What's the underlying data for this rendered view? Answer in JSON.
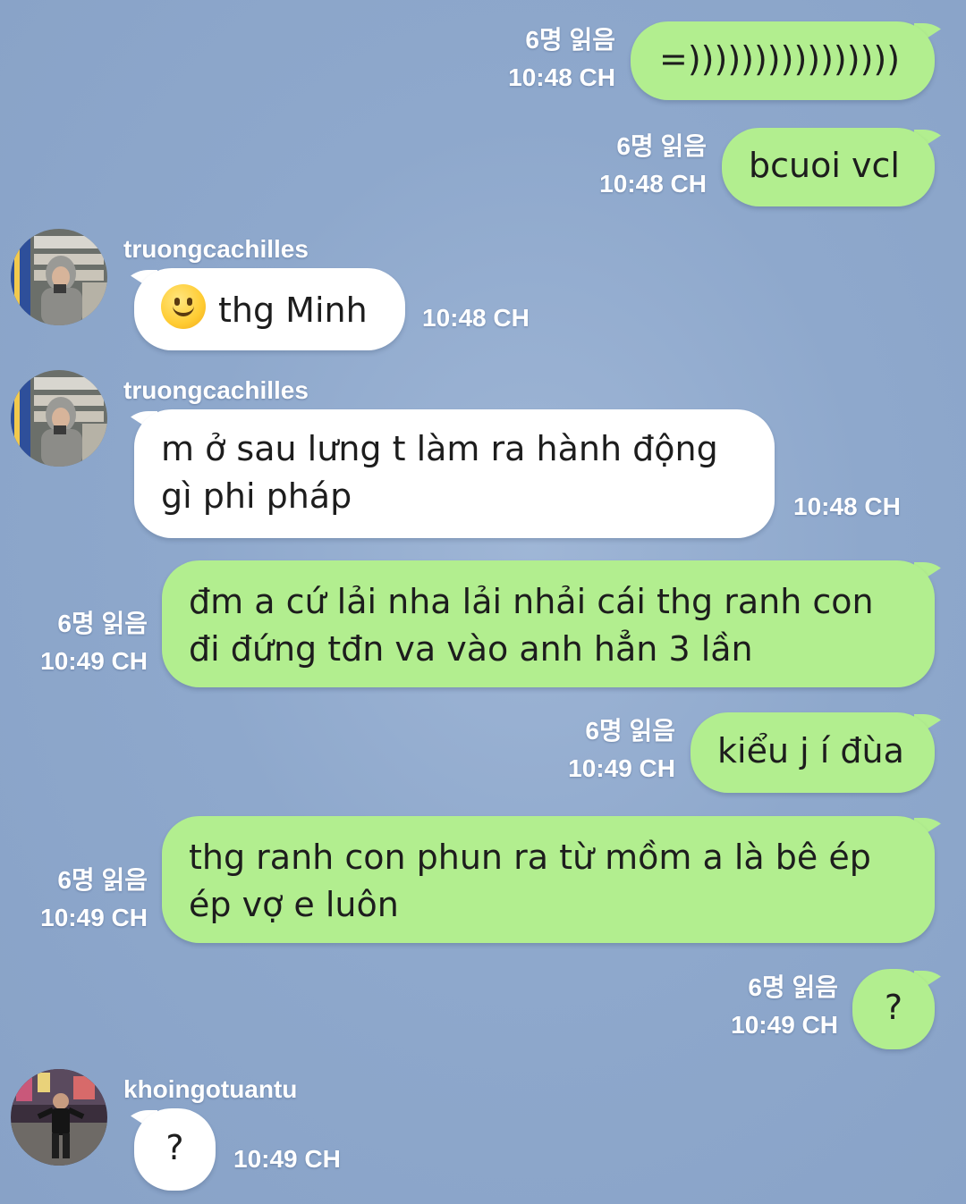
{
  "colors": {
    "background": "#8da6cb",
    "outgoing_bubble": "#b2ee8f",
    "incoming_bubble": "#ffffff"
  },
  "messages": [
    {
      "direction": "out",
      "text": "=))))))))))))))))",
      "read": "6명 읽음",
      "time": "10:48 CH"
    },
    {
      "direction": "out",
      "text": "bcuoi vcl",
      "read": "6명 읽음",
      "time": "10:48 CH"
    },
    {
      "direction": "in",
      "sender": "truongcachilles",
      "emoji": "slightly-smiling-face",
      "text": "thg Minh",
      "time": "10:48 CH"
    },
    {
      "direction": "in",
      "sender": "truongcachilles",
      "lines": [
        "m ở sau lưng t làm ra hành động",
        "gì phi pháp"
      ],
      "time": "10:48 CH"
    },
    {
      "direction": "out",
      "lines": [
        "đm a cứ lải nha lải nhải cái thg ranh con",
        "đi đứng tđn va vào anh hẳn 3 lần"
      ],
      "read": "6명 읽음",
      "time": "10:49 CH"
    },
    {
      "direction": "out",
      "text": "kiểu j í đùa",
      "read": "6명 읽음",
      "time": "10:49 CH"
    },
    {
      "direction": "out",
      "lines": [
        "thg ranh con phun ra từ mồm a là bê ép",
        "ép vợ e luôn"
      ],
      "read": "6명 읽음",
      "time": "10:49 CH"
    },
    {
      "direction": "out",
      "text": "?",
      "read": "6명 읽음",
      "time": "10:49 CH"
    },
    {
      "direction": "in",
      "sender": "khoingotuantu",
      "text": "?",
      "time": "10:49 CH"
    }
  ]
}
